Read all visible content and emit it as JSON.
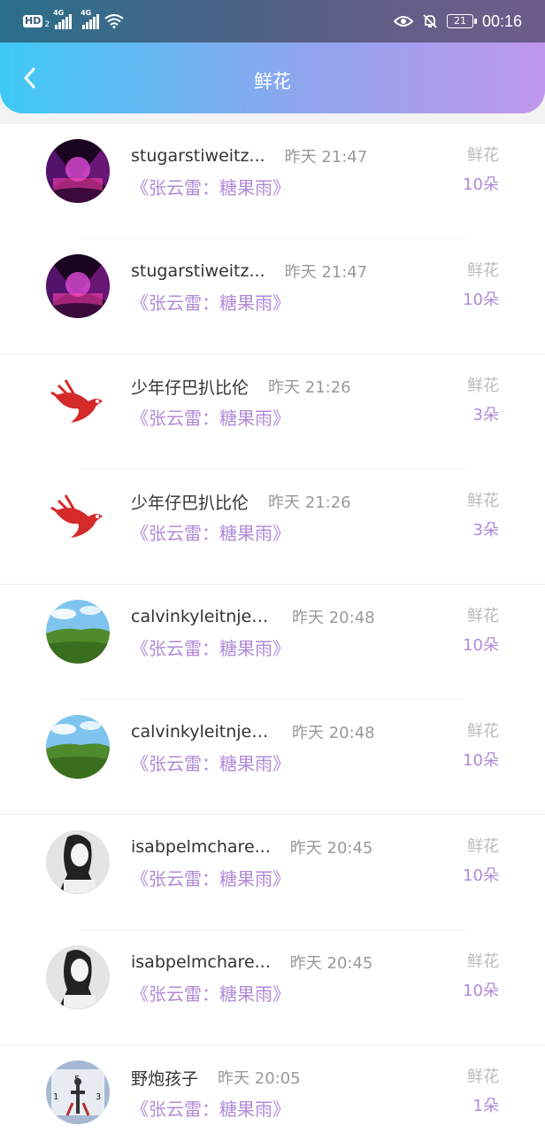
{
  "status": {
    "hd": "HD",
    "hd_sub": "2",
    "net1": "4G",
    "net2": "4G",
    "battery": "21",
    "time": "00:16"
  },
  "nav": {
    "title": "鲜花"
  },
  "rows": [
    {
      "name": "stugarstiweitz...",
      "time": "昨天 21:47",
      "gift": "《张云雷：糖果雨》",
      "label": "鲜花",
      "count": "10朵",
      "avatar": "concert"
    },
    {
      "name": "stugarstiweitz...",
      "time": "昨天 21:47",
      "gift": "《张云雷：糖果雨》",
      "label": "鲜花",
      "count": "10朵",
      "avatar": "concert"
    },
    {
      "name": "少年仔巴扒比伦",
      "time": "昨天 21:26",
      "gift": "《张云雷：糖果雨》",
      "label": "鲜花",
      "count": "3朵",
      "avatar": "bird"
    },
    {
      "name": "少年仔巴扒比伦",
      "time": "昨天 21:26",
      "gift": "《张云雷：糖果雨》",
      "label": "鲜花",
      "count": "3朵",
      "avatar": "bird"
    },
    {
      "name": "calvinkyleitnjea...",
      "time": "昨天 20:48",
      "gift": "《张云雷：糖果雨》",
      "label": "鲜花",
      "count": "10朵",
      "avatar": "landscape"
    },
    {
      "name": "calvinkyleitnjea...",
      "time": "昨天 20:48",
      "gift": "《张云雷：糖果雨》",
      "label": "鲜花",
      "count": "10朵",
      "avatar": "landscape"
    },
    {
      "name": "isabpelmchare...",
      "time": "昨天 20:45",
      "gift": "《张云雷：糖果雨》",
      "label": "鲜花",
      "count": "10朵",
      "avatar": "girl"
    },
    {
      "name": "isabpelmchare...",
      "time": "昨天 20:45",
      "gift": "《张云雷：糖果雨》",
      "label": "鲜花",
      "count": "10朵",
      "avatar": "girl"
    },
    {
      "name": "野炮孩子",
      "time": "昨天 20:05",
      "gift": "《张云雷：糖果雨》",
      "label": "鲜花",
      "count": "1朵",
      "avatar": "clock"
    }
  ]
}
